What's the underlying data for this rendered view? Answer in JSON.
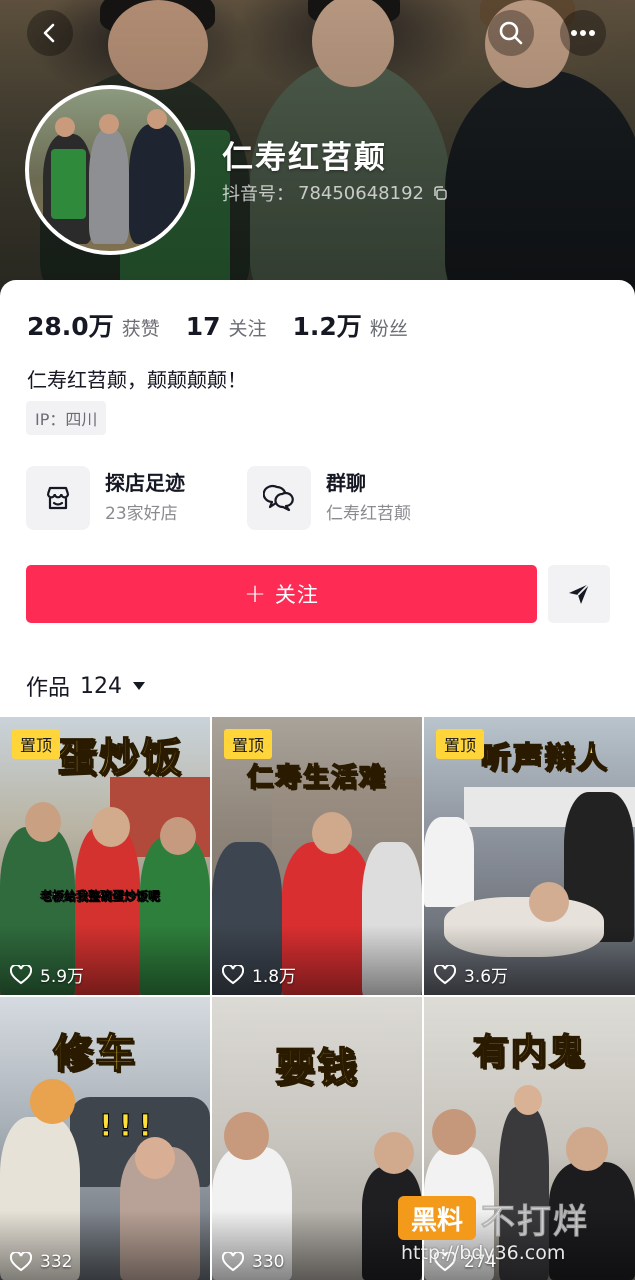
{
  "header": {
    "back_icon": "chevron-left-icon",
    "search_icon": "search-icon",
    "more_icon": "more-horizontal-icon"
  },
  "profile": {
    "name": "仁寿红苕颠",
    "douyin_id_label": "抖音号：",
    "douyin_id": "78450648192",
    "bio": "仁寿红苕颠，颠颠颠颠！",
    "ip_label": "IP：四川"
  },
  "stats": [
    {
      "value": "28.0万",
      "label": "获赞"
    },
    {
      "value": "17",
      "label": "关注"
    },
    {
      "value": "1.2万",
      "label": "粉丝"
    }
  ],
  "features": {
    "shop": {
      "title": "探店足迹",
      "subtitle": "23家好店",
      "icon": "store-icon"
    },
    "group": {
      "title": "群聊",
      "subtitle": "仁寿红苕颠",
      "icon": "chat-bubbles-icon"
    }
  },
  "actions": {
    "follow_plus": "+",
    "follow_label": "关注",
    "share_icon": "send-icon"
  },
  "works": {
    "label": "作品",
    "count": "124"
  },
  "videos": [
    {
      "pinned": "置顶",
      "title": "蛋炒饭",
      "caption": "老板给我整碗蛋炒饭呢",
      "likes": "5.9万"
    },
    {
      "pinned": "置顶",
      "title": "仁寿生活难",
      "likes": "1.8万"
    },
    {
      "pinned": "置顶",
      "title": "听声辩人",
      "likes": "3.6万"
    },
    {
      "title": "修车",
      "likes": "332",
      "exclaim": "!!!"
    },
    {
      "title": "要钱",
      "likes": "330"
    },
    {
      "title": "有内鬼",
      "likes": "274"
    }
  ],
  "watermark": {
    "badge": "黑料",
    "text": "不打烊",
    "url": "http://bdy36.com"
  },
  "colors": {
    "follow": "#fe2c55",
    "pin": "#ffd53a",
    "title_yellow": "#ffe03a"
  }
}
